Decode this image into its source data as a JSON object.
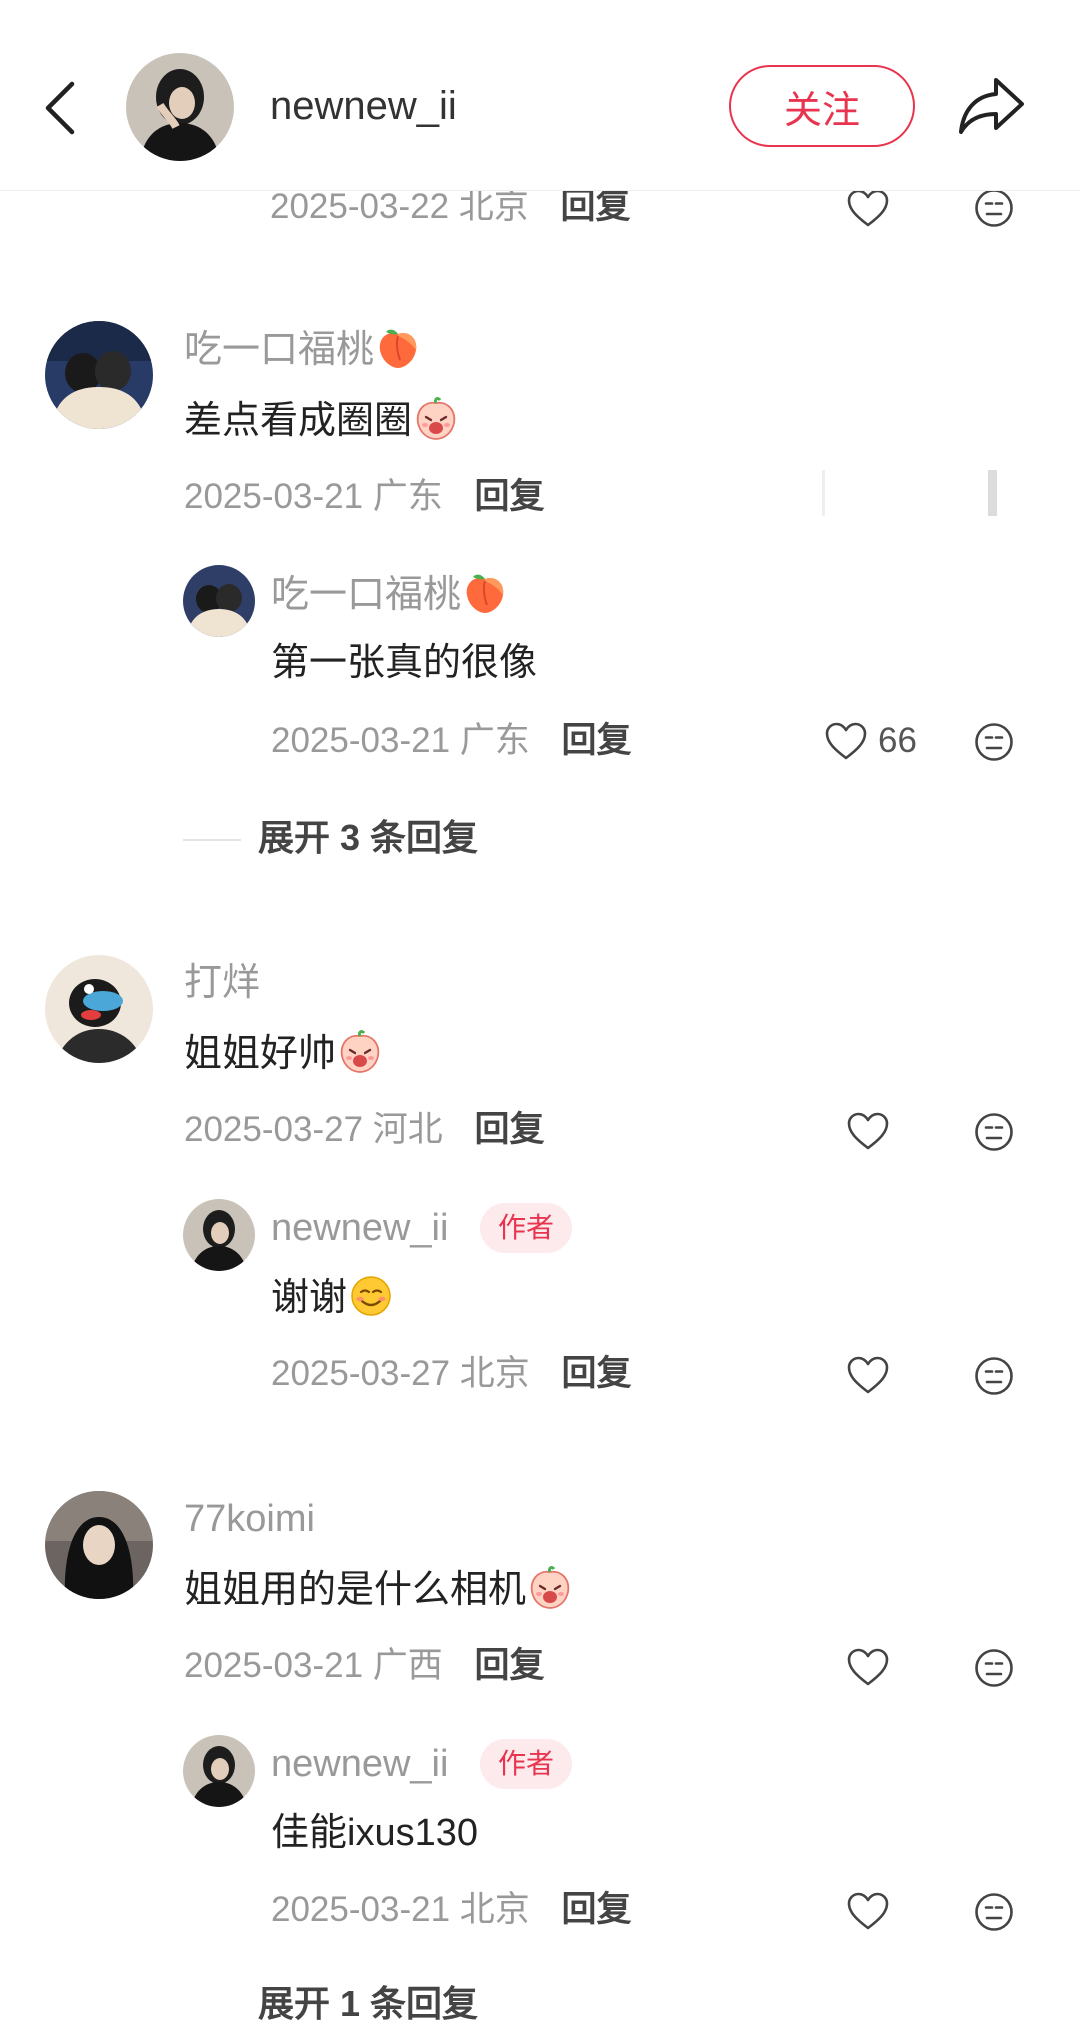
{
  "header": {
    "username": "newnew_ii",
    "follow_label": "关注"
  },
  "top_partial": {
    "date": "2025-03-22",
    "location": "北京",
    "reply": "回复"
  },
  "comments": [
    {
      "username": "吃一口福桃",
      "text": "差点看成圈圈",
      "date": "2025-03-21",
      "location": "广东",
      "reply": "回复",
      "replies": [
        {
          "username": "吃一口福桃",
          "text": "第一张真的很像",
          "date": "2025-03-21",
          "location": "广东",
          "reply": "回复",
          "likes": "66"
        }
      ],
      "expand_label": "展开 3 条回复"
    },
    {
      "username": "打烊",
      "text": "姐姐好帅",
      "date": "2025-03-27",
      "location": "河北",
      "reply": "回复",
      "replies": [
        {
          "username": "newnew_ii",
          "badge": "作者",
          "text": "谢谢",
          "date": "2025-03-27",
          "location": "北京",
          "reply": "回复"
        }
      ]
    },
    {
      "username": "77koimi",
      "text": "姐姐用的是什么相机",
      "date": "2025-03-21",
      "location": "广西",
      "reply": "回复",
      "replies": [
        {
          "username": "newnew_ii",
          "badge": "作者",
          "text": "佳能ixus130",
          "date": "2025-03-21",
          "location": "北京",
          "reply": "回复"
        }
      ],
      "expand_label": "展开 1 条回复"
    }
  ],
  "colors": {
    "accent": "#e8344e",
    "badge_bg": "#fdeaec",
    "muted_text": "#999999"
  },
  "icons": [
    "back-arrow-icon",
    "share-icon",
    "heart-icon",
    "dislike-face-icon",
    "peach-emoji",
    "peach-face-emoji",
    "smile-emoji"
  ]
}
